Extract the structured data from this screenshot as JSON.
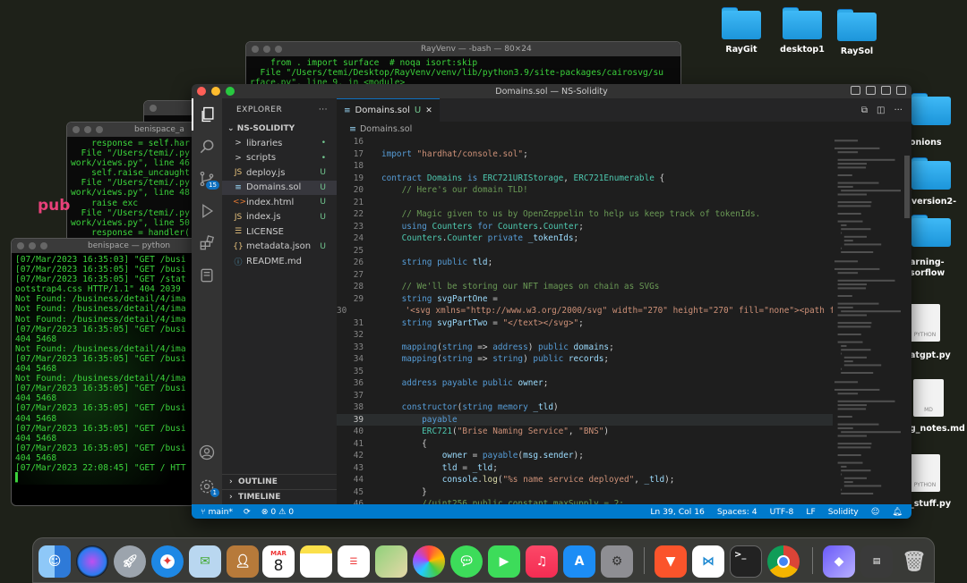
{
  "desktop": {
    "icons": [
      {
        "label": "RayGit",
        "kind": "folder"
      },
      {
        "label": "desktop1",
        "kind": "folder"
      },
      {
        "label": "RaySol",
        "kind": "folder"
      },
      {
        "label": "onions",
        "kind": "folder"
      },
      {
        "label": "-version2-",
        "kind": "folder"
      },
      {
        "label": "arning-\nsorflow",
        "kind": "folder"
      },
      {
        "label": "atgpt.py",
        "kind": "file",
        "badge": "PYTHON"
      },
      {
        "label": "g_notes.md",
        "kind": "file",
        "badge": "MD"
      },
      {
        "label": "_stuff.py",
        "kind": "file",
        "badge": "PYTHON"
      }
    ],
    "pink_text": "pub"
  },
  "terminals": {
    "ray": {
      "title": "RayVenv — -bash — 80×24",
      "lines": [
        "    from . import surface  # noqa isort:skip",
        "  File \"/Users/temi/Desktop/RayVenv/venv/lib/python3.9/site-packages/cairosvg/su",
        "rface.py\", line 9, in <module>"
      ]
    },
    "beni1": {
      "title": "benispace_a",
      "lines": [
        "    response = self.har",
        "  File \"/Users/temi/.py",
        "work/views.py\", line 46",
        "    self.raise_uncaught",
        "  File \"/Users/temi/.py",
        "work/views.py\", line 48",
        "    raise exc",
        "  File \"/Users/temi/.py",
        "work/views.py\", line 50",
        "    response = handler("
      ]
    },
    "beni2": {
      "title": "benispace — python",
      "lines": [
        "[07/Mar/2023 16:35:03] \"GET /busi",
        "[07/Mar/2023 16:35:05] \"GET /busi",
        "[07/Mar/2023 16:35:05] \"GET /stat",
        "ootstrap4.css HTTP/1.1\" 404 2039",
        "Not Found: /business/detail/4/ima",
        "Not Found: /business/detail/4/ima",
        "Not Found: /business/detail/4/ima",
        "[07/Mar/2023 16:35:05] \"GET /busi",
        "404 5468",
        "Not Found: /business/detail/4/ima",
        "[07/Mar/2023 16:35:05] \"GET /busi",
        "404 5468",
        "Not Found: /business/detail/4/ima",
        "[07/Mar/2023 16:35:05] \"GET /busi",
        "404 5468",
        "[07/Mar/2023 16:35:05] \"GET /busi",
        "404 5468",
        "[07/Mar/2023 16:35:05] \"GET /busi",
        "404 5468",
        "[07/Mar/2023 16:35:05] \"GET /busi",
        "404 5468",
        "[07/Mar/2023 22:08:45] \"GET / HTT",
        "▌"
      ]
    }
  },
  "vscode": {
    "window_title": "Domains.sol — NS-Solidity",
    "explorer_title": "EXPLORER",
    "explorer_more": "···",
    "folder_name": "NS-SOLIDITY",
    "scm_badge": "15",
    "settings_badge": "1",
    "files": [
      {
        "name": "libraries",
        "icon": ">",
        "status": "•",
        "type": "folder"
      },
      {
        "name": "scripts",
        "icon": ">",
        "status": "•",
        "type": "folder"
      },
      {
        "name": "deploy.js",
        "icon": "JS",
        "status": "U",
        "type": "js"
      },
      {
        "name": "Domains.sol",
        "icon": "≡",
        "status": "U",
        "type": "sol",
        "selected": true
      },
      {
        "name": "index.html",
        "icon": "<>",
        "status": "U",
        "type": "html"
      },
      {
        "name": "index.js",
        "icon": "JS",
        "status": "U",
        "type": "js"
      },
      {
        "name": "LICENSE",
        "icon": "☰",
        "status": "",
        "type": "text"
      },
      {
        "name": "metadata.json",
        "icon": "{}",
        "status": "U",
        "type": "json"
      },
      {
        "name": "README.md",
        "icon": "ⓘ",
        "status": "",
        "type": "md"
      }
    ],
    "outline_label": "OUTLINE",
    "timeline_label": "TIMELINE",
    "tab": {
      "name": "Domains.sol",
      "status": "U",
      "close": "✕"
    },
    "breadcrumb": "Domains.sol",
    "status": {
      "branch": "main*",
      "sync": "⟳",
      "problems": "⊗ 0 ⚠ 0",
      "position": "Ln 39, Col 16",
      "spaces": "Spaces: 4",
      "encoding": "UTF-8",
      "eol": "LF",
      "language": "Solidity"
    },
    "code_lines": [
      {
        "n": "16",
        "t": ""
      },
      {
        "n": "17",
        "t": "import \"hardhat/console.sol\";"
      },
      {
        "n": "18",
        "t": ""
      },
      {
        "n": "19",
        "t": "contract Domains is ERC721URIStorage, ERC721Enumerable {"
      },
      {
        "n": "20",
        "t": "    // Here's our domain TLD!"
      },
      {
        "n": "21",
        "t": ""
      },
      {
        "n": "22",
        "t": "    // Magic given to us by OpenZeppelin to help us keep track of tokenIds."
      },
      {
        "n": "23",
        "t": "    using Counters for Counters.Counter;"
      },
      {
        "n": "24",
        "t": "    Counters.Counter private _tokenIds;"
      },
      {
        "n": "25",
        "t": ""
      },
      {
        "n": "26",
        "t": "    string public tld;"
      },
      {
        "n": "27",
        "t": ""
      },
      {
        "n": "28",
        "t": "    // We'll be storing our NFT images on chain as SVGs"
      },
      {
        "n": "29",
        "t": "    string svgPartOne ="
      },
      {
        "n": "30",
        "t": "        '<svg xmlns=\"http://www.w3.org/2000/svg\" width=\"270\" height=\"270\" fill=\"none\"><path f"
      },
      {
        "n": "31",
        "t": "    string svgPartTwo = \"</text></svg>\";"
      },
      {
        "n": "32",
        "t": ""
      },
      {
        "n": "33",
        "t": "    mapping(string => address) public domains;"
      },
      {
        "n": "34",
        "t": "    mapping(string => string) public records;"
      },
      {
        "n": "35",
        "t": ""
      },
      {
        "n": "36",
        "t": "    address payable public owner;"
      },
      {
        "n": "37",
        "t": ""
      },
      {
        "n": "38",
        "t": "    constructor(string memory _tld)"
      },
      {
        "n": "39",
        "t": "        payable"
      },
      {
        "n": "40",
        "t": "        ERC721(\"Brise Naming Service\", \"BNS\")"
      },
      {
        "n": "41",
        "t": "        {"
      },
      {
        "n": "42",
        "t": "            owner = payable(msg.sender);"
      },
      {
        "n": "43",
        "t": "            tld = _tld;"
      },
      {
        "n": "44",
        "t": "            console.log(\"%s name service deployed\", _tld);"
      },
      {
        "n": "45",
        "t": "        }"
      },
      {
        "n": "46",
        "t": "        //uint256 public constant maxSupply = 2;"
      }
    ]
  },
  "dock": {
    "apps": [
      "Finder",
      "Siri",
      "Launchpad",
      "Safari",
      "Mail",
      "Contacts",
      "Calendar",
      "Notes",
      "Reminders",
      "Maps",
      "Photos",
      "Messages",
      "FaceTime",
      "Music",
      "App Store",
      "System Preferences",
      "Brave",
      "VS Code",
      "Terminal",
      "Chrome",
      "Preview",
      "Screenshot",
      "Trash"
    ],
    "calendar_month": "MAR",
    "calendar_day": "8"
  }
}
